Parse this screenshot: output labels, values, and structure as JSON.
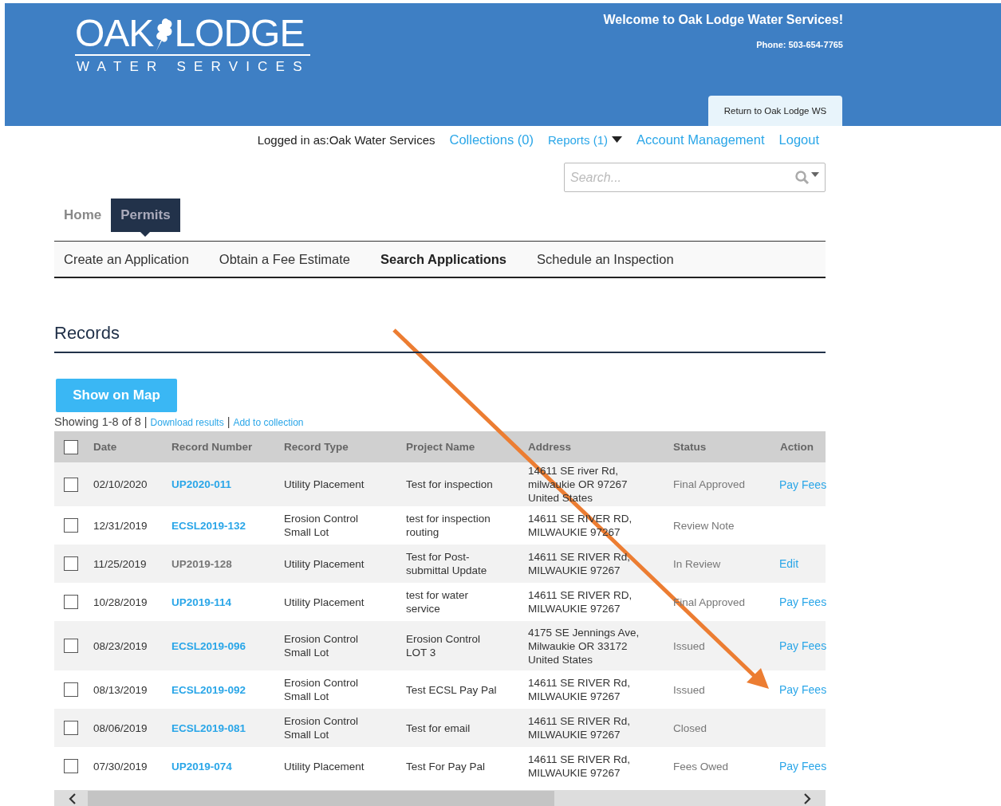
{
  "header": {
    "logo": {
      "word_1": "OAK",
      "word_2": "LODGE",
      "tagline": "WATER SERVICES"
    },
    "welcome": "Welcome to Oak Lodge Water Services!",
    "phone": "Phone: 503-654-7765",
    "return_tab": "Return to Oak Lodge WS"
  },
  "user_bar": {
    "logged_in": "Logged in as:Oak Water Services",
    "links": [
      {
        "label": "Collections (0)",
        "dropdown": false
      },
      {
        "label": "Reports (1)",
        "dropdown": true
      },
      {
        "label": "Account Management",
        "dropdown": false
      },
      {
        "label": "Logout",
        "dropdown": false
      }
    ]
  },
  "search": {
    "placeholder": "Search..."
  },
  "tabs": [
    {
      "label": "Home",
      "selected": false
    },
    {
      "label": "Permits",
      "selected": true
    }
  ],
  "subnav": [
    {
      "label": "Create an Application",
      "selected": false
    },
    {
      "label": "Obtain a Fee Estimate",
      "selected": false
    },
    {
      "label": "Search Applications",
      "selected": true
    },
    {
      "label": "Schedule an Inspection",
      "selected": false
    }
  ],
  "records": {
    "title": "Records",
    "map_button": "Show on Map",
    "showing": "Showing 1-8 of 8",
    "separator": "|",
    "links": [
      "Download results",
      "Add to collection"
    ],
    "select_all": {
      "checked": false
    },
    "columns": [
      "Date",
      "Record Number",
      "Record Type",
      "Project Name",
      "Address",
      "Status",
      "Action"
    ],
    "rows": [
      {
        "checked": false,
        "date": "02/10/2020",
        "record": {
          "text": "UP2020-011",
          "link": true
        },
        "type": "Utility Placement",
        "project": "Test for inspection",
        "address": "14611 SE river Rd,\nmilwaukie OR 97267\nUnited States",
        "status": "Final Approved",
        "action": "Pay Fees"
      },
      {
        "checked": false,
        "date": "12/31/2019",
        "record": {
          "text": "ECSL2019-132",
          "link": true
        },
        "type": "Erosion Control\nSmall Lot",
        "project": "test for inspection\nrouting",
        "address": "14611 SE RIVER RD,\nMILWAUKIE 97267",
        "status": "Review Note"
      },
      {
        "checked": false,
        "date": "11/25/2019",
        "record": {
          "text": "UP2019-128",
          "link": false
        },
        "type": "Utility Placement",
        "project": "Test for Post-\nsubmittal Update",
        "address": "14611 SE RIVER Rd,\nMILWAUKIE 97267",
        "status": "In Review",
        "action": "Edit"
      },
      {
        "checked": false,
        "date": "10/28/2019",
        "record": {
          "text": "UP2019-114",
          "link": true
        },
        "type": "Utility Placement",
        "project": "test for water\nservice",
        "address": "14611 SE RIVER RD,\nMILWAUKIE 97267",
        "status": "Final Approved",
        "action": "Pay Fees"
      },
      {
        "checked": false,
        "date": "08/23/2019",
        "record": {
          "text": "ECSL2019-096",
          "link": true
        },
        "type": "Erosion Control\nSmall Lot",
        "project": "Erosion Control\nLOT 3",
        "address": "4175 SE Jennings Ave,\nMilwaukie OR 33172\nUnited States",
        "status": "Issued",
        "action": "Pay Fees"
      },
      {
        "checked": false,
        "date": "08/13/2019",
        "record": {
          "text": "ECSL2019-092",
          "link": true
        },
        "type": "Erosion Control\nSmall Lot",
        "project": "Test ECSL Pay Pal",
        "address": "14611 SE RIVER Rd,\nMILWAUKIE 97267",
        "status": "Issued",
        "action": "Pay Fees"
      },
      {
        "checked": false,
        "date": "08/06/2019",
        "record": {
          "text": "ECSL2019-081",
          "link": true
        },
        "type": "Erosion Control\nSmall Lot",
        "project": "Test for email",
        "address": "14611 SE RIVER Rd,\nMILWAUKIE 97267",
        "status": "Closed"
      },
      {
        "checked": false,
        "date": "07/30/2019",
        "record": {
          "text": "UP2019-074",
          "link": true
        },
        "type": "Utility Placement",
        "project": "Test For Pay Pal",
        "address": "14611 SE RIVER Rd,\nMILWAUKIE 97267",
        "status": "Fees Owed",
        "action": "Pay Fees"
      }
    ]
  }
}
